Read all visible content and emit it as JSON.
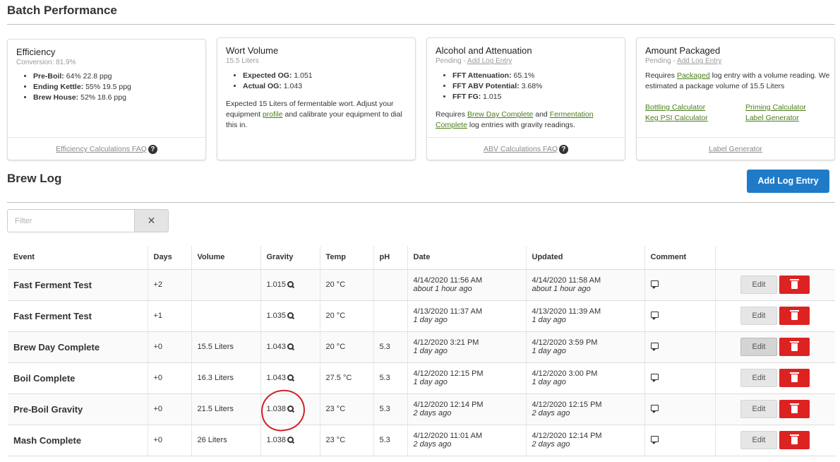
{
  "batch_performance": {
    "title": "Batch Performance",
    "cards": [
      {
        "title": "Efficiency",
        "subtitle": "Conversion: 81.9%",
        "items": [
          {
            "label": "Pre-Boil:",
            "value": "64% 22.8 ppg"
          },
          {
            "label": "Ending Kettle:",
            "value": "55% 19.5 ppg"
          },
          {
            "label": "Brew House:",
            "value": "52% 18.6 ppg"
          }
        ],
        "footer": "Efficiency Calculations FAQ"
      },
      {
        "title": "Wort Volume",
        "subtitle": "15.5 Liters",
        "items": [
          {
            "label": "Expected OG:",
            "value": "1.051"
          },
          {
            "label": "Actual OG:",
            "value": "1.043"
          }
        ],
        "note_pre": "Expected 15 Liters of fermentable wort. Adjust your equipment",
        "note_link": "profile",
        "note_post": "and calibrate your equipment to dial this in."
      },
      {
        "title": "Alcohol and Attenuation",
        "subtitle_pre": "Pending -",
        "subtitle_link": "Add Log Entry",
        "items": [
          {
            "label": "FFT Attenuation:",
            "value": "65.1%"
          },
          {
            "label": "FFT ABV Potential:",
            "value": "3.68%"
          },
          {
            "label": "FFT FG:",
            "value": "1.015"
          }
        ],
        "note_pre": "Requires",
        "note_link1": "Brew Day Complete",
        "note_mid": "and",
        "note_link2": "Fermentation Complete",
        "note_post": "log entries with gravity readings.",
        "footer": "ABV Calculations FAQ"
      },
      {
        "title": "Amount Packaged",
        "subtitle_pre": "Pending -",
        "subtitle_link": "Add Log Entry",
        "note_pre": "Requires",
        "note_link": "Packaged",
        "note_post": "log entry with a volume reading. We estimated a package volume of 15.5 Liters",
        "links": [
          "Bottling Calculator",
          "Priming Calculator",
          "Keg PSI Calculator",
          "Label Generator"
        ],
        "footer": "Label Generator"
      }
    ]
  },
  "brew_log": {
    "title": "Brew Log",
    "add_button": "Add Log Entry",
    "filter_placeholder": "Filter",
    "filter_clear": "✕",
    "columns": [
      "Event",
      "Days",
      "Volume",
      "Gravity",
      "Temp",
      "pH",
      "Date",
      "Updated",
      "Comment",
      ""
    ],
    "rows": [
      {
        "event": "Fast Ferment Test",
        "days": "+2",
        "volume": "",
        "gravity": "1.015",
        "temp": "20 °C",
        "ph": "",
        "date": "4/14/2020 11:56 AM",
        "date_rel": "about 1 hour ago",
        "updated": "4/14/2020 11:58 AM",
        "updated_rel": "about 1 hour ago"
      },
      {
        "event": "Fast Ferment Test",
        "days": "+1",
        "volume": "",
        "gravity": "1.035",
        "temp": "20 °C",
        "ph": "",
        "date": "4/13/2020 11:37 AM",
        "date_rel": "1 day ago",
        "updated": "4/13/2020 11:39 AM",
        "updated_rel": "1 day ago"
      },
      {
        "event": "Brew Day Complete",
        "days": "+0",
        "volume": "15.5 Liters",
        "gravity": "1.043",
        "temp": "20 °C",
        "ph": "5.3",
        "date": "4/12/2020 3:21 PM",
        "date_rel": "1 day ago",
        "updated": "4/12/2020 3:59 PM",
        "updated_rel": "1 day ago"
      },
      {
        "event": "Boil Complete",
        "days": "+0",
        "volume": "16.3 Liters",
        "gravity": "1.043",
        "temp": "27.5 °C",
        "ph": "5.3",
        "date": "4/12/2020 12:15 PM",
        "date_rel": "1 day ago",
        "updated": "4/12/2020 3:00 PM",
        "updated_rel": "1 day ago"
      },
      {
        "event": "Pre-Boil Gravity",
        "days": "+0",
        "volume": "21.5 Liters",
        "gravity": "1.038",
        "temp": "23 °C",
        "ph": "5.3",
        "date": "4/12/2020 12:14 PM",
        "date_rel": "2 days ago",
        "updated": "4/12/2020 12:15 PM",
        "updated_rel": "2 days ago"
      },
      {
        "event": "Mash Complete",
        "days": "+0",
        "volume": "26 Liters",
        "gravity": "1.038",
        "temp": "23 °C",
        "ph": "5.3",
        "date": "4/12/2020 11:01 AM",
        "date_rel": "2 days ago",
        "updated": "4/12/2020 12:14 PM",
        "updated_rel": "2 days ago"
      }
    ],
    "edit_label": "Edit"
  },
  "colors": {
    "primary": "#1f7bc8",
    "danger": "#dd2222",
    "link": "#4a7d1a",
    "annotation": "#d0212a"
  }
}
